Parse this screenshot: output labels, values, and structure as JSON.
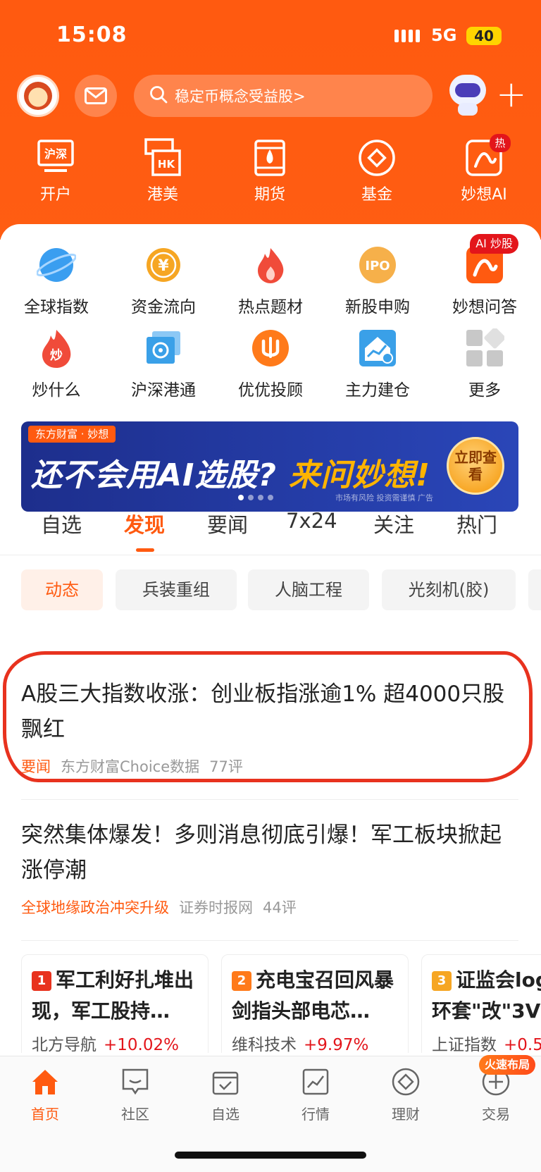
{
  "status": {
    "time": "15:08",
    "network": "5G",
    "battery": "40"
  },
  "search": {
    "placeholder": "稳定币概念受益股>"
  },
  "top_nav": [
    {
      "label": "开户",
      "icon": "account-open-icon"
    },
    {
      "label": "港美",
      "icon": "hk-us-market-icon"
    },
    {
      "label": "期货",
      "icon": "futures-icon"
    },
    {
      "label": "基金",
      "icon": "fund-icon"
    },
    {
      "label": "妙想AI",
      "icon": "miaoxiang-ai-icon",
      "badge": "热"
    }
  ],
  "grid": [
    {
      "label": "全球指数",
      "icon": "globe-icon",
      "color": "#3a9ef0"
    },
    {
      "label": "资金流向",
      "icon": "yuan-coin-icon",
      "color": "#f6a623"
    },
    {
      "label": "热点题材",
      "icon": "flame-icon",
      "color": "#f04b3a"
    },
    {
      "label": "新股申购",
      "icon": "ipo-icon",
      "color": "#f6a623"
    },
    {
      "label": "妙想问答",
      "icon": "miaoxiang-qa-icon",
      "color": "#ff5a10",
      "badge": "AI 炒股"
    },
    {
      "label": "炒什么",
      "icon": "chao-flame-icon",
      "color": "#f04b3a"
    },
    {
      "label": "沪深港通",
      "icon": "hk-connect-icon",
      "color": "#3aa0e8"
    },
    {
      "label": "优优投顾",
      "icon": "advisor-icon",
      "color": "#ff7a1a"
    },
    {
      "label": "主力建仓",
      "icon": "house-chart-icon",
      "color": "#3aa0e8"
    },
    {
      "label": "更多",
      "icon": "more-grid-icon",
      "color": "#cccccc"
    }
  ],
  "banner": {
    "brand": "东方财富 · 妙想",
    "slogan_main": "还不会用AI选股?",
    "slogan_accent": "来问妙想!",
    "cta": "立即查看",
    "risk": "市场有风险 投资需谨慎 广告"
  },
  "tabs": [
    "自选",
    "发现",
    "要闻",
    "7x24",
    "关注",
    "热门"
  ],
  "active_tab": "发现",
  "chips": [
    "动态",
    "兵装重组",
    "人脑工程",
    "光刻机(胶)"
  ],
  "news": [
    {
      "title": "A股三大指数收涨：创业板指涨逾1% 超4000只股飘红",
      "tag": "要闻",
      "source": "东方财富Choice数据",
      "comments": "77评"
    },
    {
      "title": "突然集体爆发！多则消息彻底引爆！军工板块掀起涨停潮",
      "tag": "全球地缘政治冲突升级",
      "source": "证券时报网",
      "comments": "44评"
    }
  ],
  "hot_cards": [
    {
      "rank": "1",
      "title": "军工利好扎堆出现，军工股持…",
      "stock": "北方导航",
      "change": "+10.02%",
      "rank_color": "#e8321e"
    },
    {
      "rank": "2",
      "title": "充电宝召回风暴剑指头部电芯…",
      "stock": "维科技术",
      "change": "+9.97%",
      "rank_color": "#ff7a1a"
    },
    {
      "rank": "3",
      "title": "证监会log环套\"改\"3V",
      "stock": "上证指数",
      "change": "+0.5",
      "rank_color": "#f6a623"
    }
  ],
  "tabbar": [
    {
      "label": "首页",
      "icon": "home-icon"
    },
    {
      "label": "社区",
      "icon": "community-icon"
    },
    {
      "label": "自选",
      "icon": "watchlist-icon"
    },
    {
      "label": "行情",
      "icon": "market-chart-icon"
    },
    {
      "label": "理财",
      "icon": "wealth-icon"
    },
    {
      "label": "交易",
      "icon": "trade-icon"
    }
  ],
  "tabbar_badge": "火速布局",
  "colors": {
    "brand": "#ff5a10",
    "up": "#e3151b",
    "annotation": "#e8321e"
  }
}
